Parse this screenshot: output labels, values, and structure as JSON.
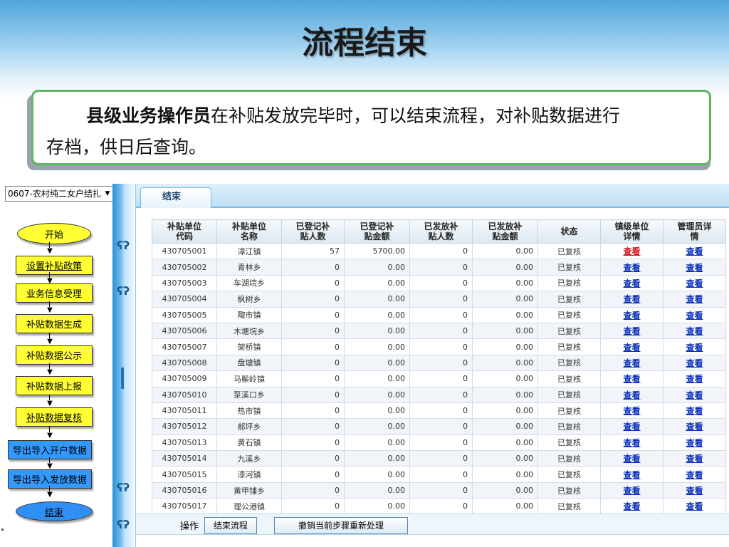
{
  "slide": {
    "title": "流程结束",
    "callout": {
      "role": "县级业务操作员",
      "line1": "在补贴发放完毕时，可以结束流程，对补贴数据进行",
      "line2": "存档，供日后查询。"
    }
  },
  "sidebar": {
    "select_value": "0607-农村纯二女户结扎",
    "flow": {
      "start": "开始",
      "steps": [
        "设置补贴政策",
        "业务信息受理",
        "补贴数据生成",
        "补贴数据公示",
        "补贴数据上报",
        "补贴数据复核",
        "导出导入开户数据",
        "导出导入发放数据"
      ],
      "end": "结束"
    }
  },
  "panel": {
    "tab_label": "结束",
    "columns": [
      "补贴单位\n代码",
      "补贴单位\n名称",
      "已登记补\n贴人数",
      "已登记补\n贴金额",
      "已发放补\n贴人数",
      "已发放补\n贴金额",
      "状态",
      "镇级单位\n详情",
      "管理员详\n情"
    ],
    "link_text": "查看",
    "rows": [
      {
        "code": "430705001",
        "name": "漳江镇",
        "reg_count": "57",
        "reg_amount": "5700.00",
        "paid_count": "0",
        "paid_amount": "0.00",
        "status": "已复核"
      },
      {
        "code": "430705002",
        "name": "青林乡",
        "reg_count": "0",
        "reg_amount": "0.00",
        "paid_count": "0",
        "paid_amount": "0.00",
        "status": "已复核"
      },
      {
        "code": "430705003",
        "name": "车湖垸乡",
        "reg_count": "0",
        "reg_amount": "0.00",
        "paid_count": "0",
        "paid_amount": "0.00",
        "status": "已复核"
      },
      {
        "code": "430705004",
        "name": "枫树乡",
        "reg_count": "0",
        "reg_amount": "0.00",
        "paid_count": "0",
        "paid_amount": "0.00",
        "status": "已复核"
      },
      {
        "code": "430705005",
        "name": "陬市镇",
        "reg_count": "0",
        "reg_amount": "0.00",
        "paid_count": "0",
        "paid_amount": "0.00",
        "status": "已复核"
      },
      {
        "code": "430705006",
        "name": "木塘垸乡",
        "reg_count": "0",
        "reg_amount": "0.00",
        "paid_count": "0",
        "paid_amount": "0.00",
        "status": "已复核"
      },
      {
        "code": "430705007",
        "name": "架桥镇",
        "reg_count": "0",
        "reg_amount": "0.00",
        "paid_count": "0",
        "paid_amount": "0.00",
        "status": "已复核"
      },
      {
        "code": "430705008",
        "name": "盘塘镇",
        "reg_count": "0",
        "reg_amount": "0.00",
        "paid_count": "0",
        "paid_amount": "0.00",
        "status": "已复核"
      },
      {
        "code": "430705009",
        "name": "马鬃岭镇",
        "reg_count": "0",
        "reg_amount": "0.00",
        "paid_count": "0",
        "paid_amount": "0.00",
        "status": "已复核"
      },
      {
        "code": "430705010",
        "name": "泵溪口乡",
        "reg_count": "0",
        "reg_amount": "0.00",
        "paid_count": "0",
        "paid_amount": "0.00",
        "status": "已复核"
      },
      {
        "code": "430705011",
        "name": "热市镇",
        "reg_count": "0",
        "reg_amount": "0.00",
        "paid_count": "0",
        "paid_amount": "0.00",
        "status": "已复核"
      },
      {
        "code": "430705012",
        "name": "郝坪乡",
        "reg_count": "0",
        "reg_amount": "0.00",
        "paid_count": "0",
        "paid_amount": "0.00",
        "status": "已复核"
      },
      {
        "code": "430705013",
        "name": "黄石镇",
        "reg_count": "0",
        "reg_amount": "0.00",
        "paid_count": "0",
        "paid_amount": "0.00",
        "status": "已复核"
      },
      {
        "code": "430705014",
        "name": "九溪乡",
        "reg_count": "0",
        "reg_amount": "0.00",
        "paid_count": "0",
        "paid_amount": "0.00",
        "status": "已复核"
      },
      {
        "code": "430705015",
        "name": "漆河镇",
        "reg_count": "0",
        "reg_amount": "0.00",
        "paid_count": "0",
        "paid_amount": "0.00",
        "status": "已复核"
      },
      {
        "code": "430705016",
        "name": "黄甲铺乡",
        "reg_count": "0",
        "reg_amount": "0.00",
        "paid_count": "0",
        "paid_amount": "0.00",
        "status": "已复核"
      },
      {
        "code": "430705017",
        "name": "理公港镇",
        "reg_count": "0",
        "reg_amount": "0.00",
        "paid_count": "0",
        "paid_amount": "0.00",
        "status": "已复核"
      }
    ],
    "footer": {
      "op_label": "操作",
      "end_button": "结束流程",
      "undo_button": "撤销当前步骤重新处理"
    }
  },
  "colors": {
    "flow_yellow": "#ffff33",
    "flow_blue": "#3399ff",
    "link_blue": "#0a2fb8",
    "link_red": "#d4141c",
    "callout_border": "#5cb85c"
  }
}
